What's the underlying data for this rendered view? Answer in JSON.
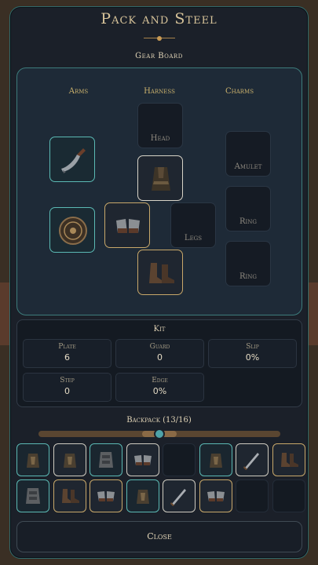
{
  "window": {
    "title": "Pack and Steel"
  },
  "board": {
    "title": "Gear Board",
    "columns": [
      "Arms",
      "Harness",
      "Charms"
    ],
    "slots": {
      "head": "Head",
      "legs": "Legs",
      "amulet": "Amulet",
      "ring1": "Ring",
      "ring2": "Ring"
    },
    "equipped": {
      "arms_top": "knife-icon",
      "arms_bottom": "round-shield-icon",
      "body": "cloak-armor-icon",
      "hands": "gauntlets-icon",
      "feet": "boots-icon"
    }
  },
  "kit": {
    "title": "Kit",
    "stats": [
      {
        "name": "Plate",
        "value": "6"
      },
      {
        "name": "Guard",
        "value": "0"
      },
      {
        "name": "Slip",
        "value": "0%"
      },
      {
        "name": "Step",
        "value": "0"
      },
      {
        "name": "Edge",
        "value": "0%"
      }
    ]
  },
  "backpack": {
    "title": "Backpack (13/16)",
    "scroll_position": 0.5,
    "items": [
      {
        "icon": "vest-icon",
        "rarity": "teal"
      },
      {
        "icon": "vest-icon",
        "rarity": "white"
      },
      {
        "icon": "plate-icon",
        "rarity": "teal"
      },
      {
        "icon": "gauntlets-icon",
        "rarity": "white"
      },
      {
        "icon": "empty",
        "rarity": "none"
      },
      {
        "icon": "vest-icon",
        "rarity": "teal"
      },
      {
        "icon": "sword-icon",
        "rarity": "white"
      },
      {
        "icon": "boots-icon",
        "rarity": "gold"
      },
      {
        "icon": "plate-icon",
        "rarity": "teal"
      },
      {
        "icon": "boots-icon",
        "rarity": "gold"
      },
      {
        "icon": "gauntlets-icon",
        "rarity": "gold"
      },
      {
        "icon": "vest-icon",
        "rarity": "teal"
      },
      {
        "icon": "sword-icon",
        "rarity": "white"
      },
      {
        "icon": "gauntlets-icon",
        "rarity": "gold"
      },
      {
        "icon": "empty",
        "rarity": "none"
      },
      {
        "icon": "empty",
        "rarity": "none"
      }
    ]
  },
  "footer": {
    "close_label": "Close"
  },
  "colors": {
    "accent_teal": "#5bb9b4",
    "accent_gold": "#c8a86a",
    "panel": "#1b2029"
  }
}
